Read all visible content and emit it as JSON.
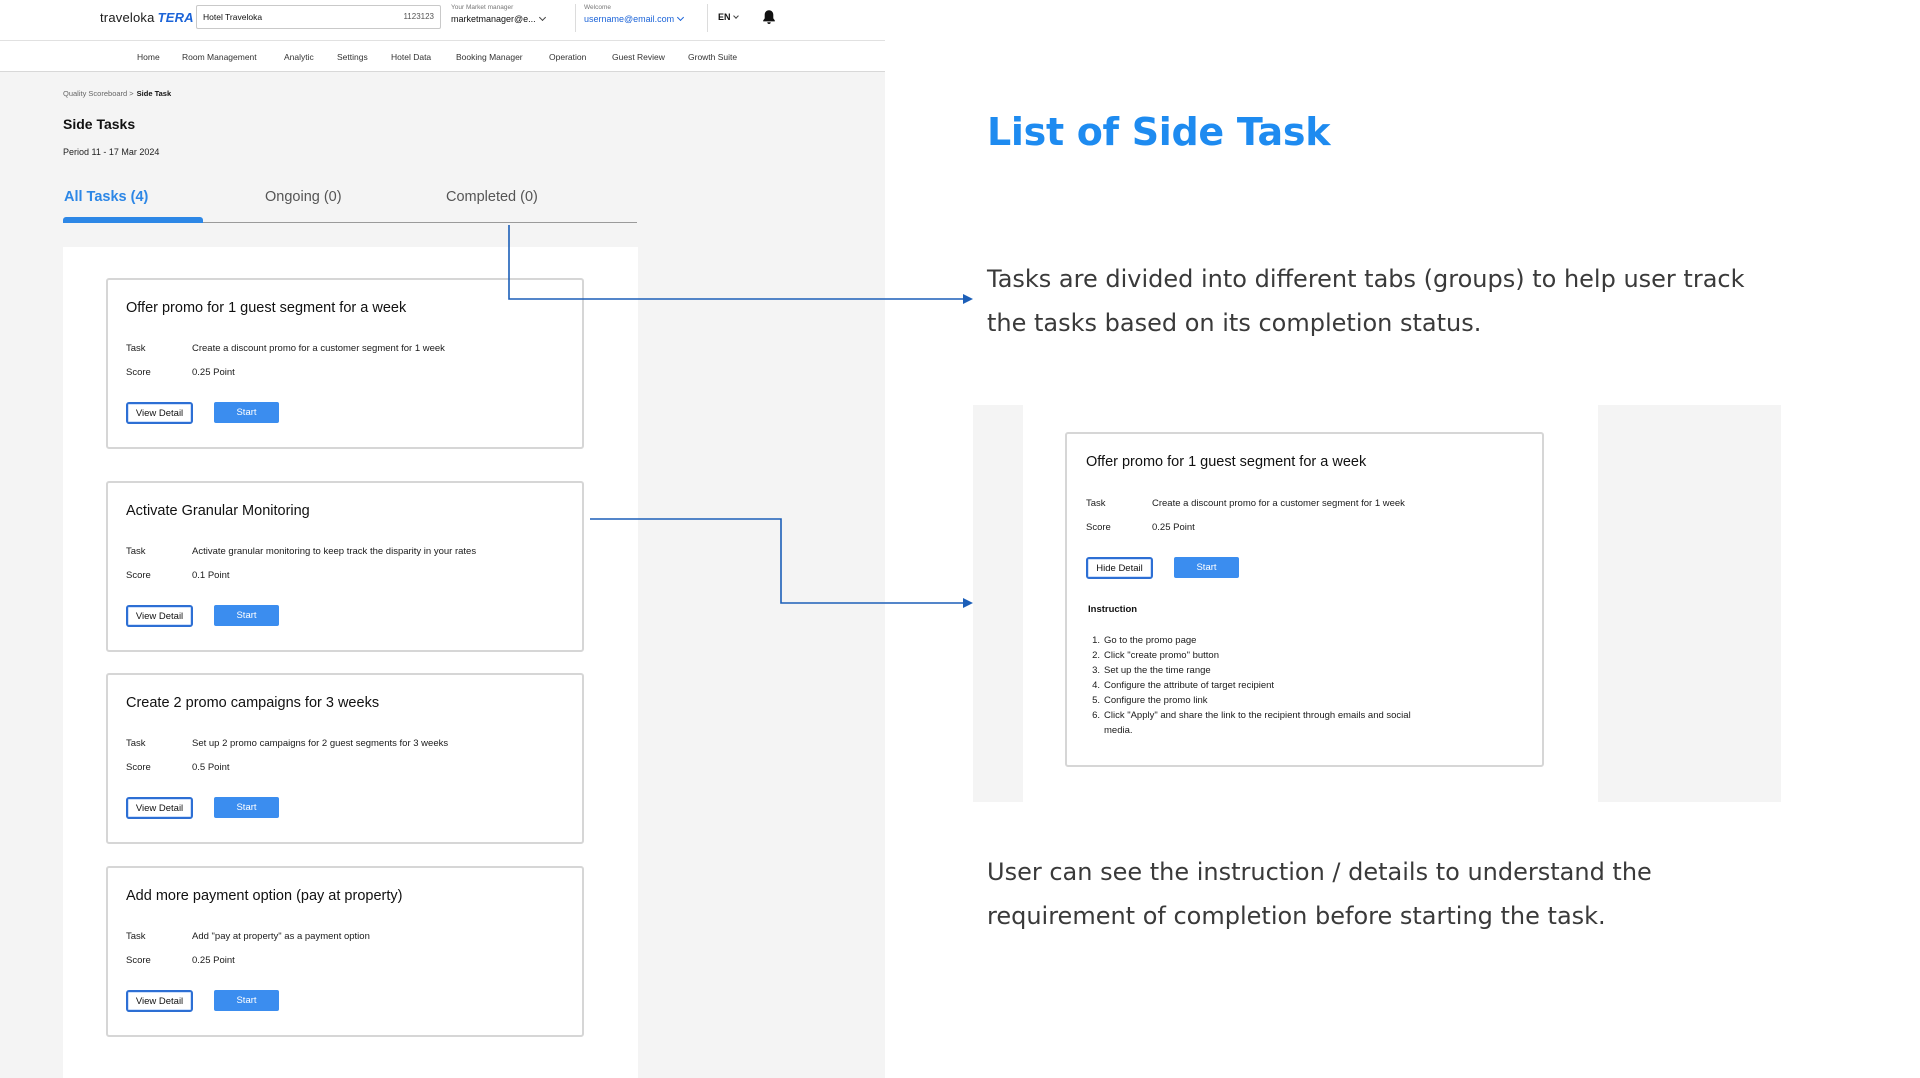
{
  "app": {
    "logo_text": "traveloka",
    "logo_suffix": "TERA",
    "hotel_field": {
      "name": "Hotel Traveloka",
      "id": "1123123"
    },
    "market_manager": {
      "caption": "Your Market manager",
      "value": "marketmanager@e..."
    },
    "welcome": {
      "caption": "Welcome",
      "value": "username@email.com"
    },
    "language": "EN",
    "nav": [
      "Home",
      "Room Management",
      "Analytic",
      "Settings",
      "Hotel Data",
      "Booking Manager",
      "Operation",
      "Guest Review",
      "Growth Suite"
    ],
    "breadcrumb": {
      "parent": "Quality Scoreboard >",
      "current": "Side Task"
    },
    "page_title": "Side Tasks",
    "period": "Period 11 - 17 Mar 2024",
    "tabs": [
      {
        "label": "All Tasks (4)",
        "active": true
      },
      {
        "label": "Ongoing (0)",
        "active": false
      },
      {
        "label": "Completed (0)",
        "active": false
      }
    ],
    "task_label": "Task",
    "score_label": "Score",
    "view_detail_label": "View Detail",
    "start_label": "Start",
    "tasks": [
      {
        "title": "Offer promo for 1 guest segment for a week",
        "task": "Create a discount promo for a customer segment for 1 week",
        "score": "0.25 Point"
      },
      {
        "title": "Activate Granular Monitoring",
        "task": "Activate granular monitoring to keep track the disparity in your rates",
        "score": "0.1 Point"
      },
      {
        "title": "Create 2 promo campaigns for 3 weeks",
        "task": "Set up 2 promo campaigns for 2 guest segments for 3 weeks",
        "score": "0.5 Point"
      },
      {
        "title": "Add more payment option (pay at property)",
        "task": "Add \"pay at property\" as a payment option",
        "score": "0.25 Point"
      }
    ]
  },
  "annotation": {
    "title": "List of Side Task",
    "text1": "Tasks are divided into different tabs (groups) to help user track the tasks based on its completion status.",
    "text2": "User can see the instruction / details to understand the requirement of completion before starting the task."
  },
  "detail_preview": {
    "title": "Offer promo for 1 guest segment for a week",
    "task_label": "Task",
    "task": "Create a discount promo for a customer segment for 1 week",
    "score_label": "Score",
    "score": "0.25 Point",
    "hide_detail_label": "Hide Detail",
    "start_label": "Start",
    "instruction_title": "Instruction",
    "steps": [
      {
        "n": "1.",
        "text": "Go to the promo page"
      },
      {
        "n": "2.",
        "text": "Click \"create promo\" button"
      },
      {
        "n": "3.",
        "text": "Set up the the time range"
      },
      {
        "n": "4.",
        "text": "Configure the attribute of target recipient"
      },
      {
        "n": "5.",
        "text": "Configure the promo link"
      },
      {
        "n": "6.",
        "text": "Click \"Apply\" and share the link to the recipient through emails and social media."
      }
    ]
  },
  "colors": {
    "accent": "#2d87e6",
    "button": "#3b8def",
    "annotation_title": "#1e8bf0",
    "arrow": "#1c5fb8"
  }
}
